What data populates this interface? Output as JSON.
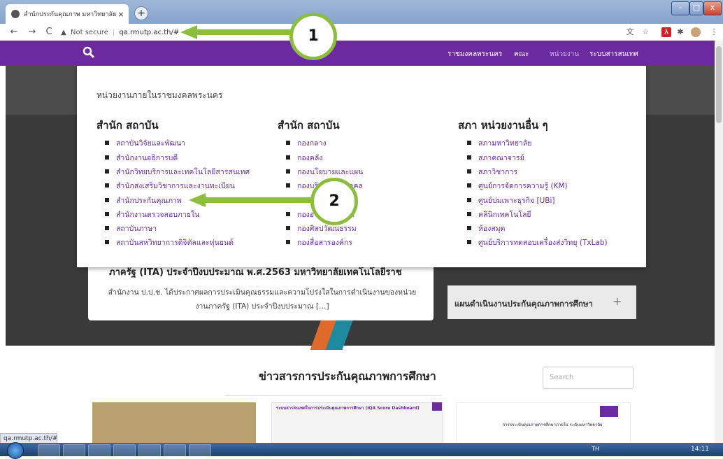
{
  "browser": {
    "tab_title": "สำนักประกันคุณภาพ มหาวิทยาลัยเ",
    "tab_close": "×",
    "new_tab": "+",
    "nav_back": "←",
    "nav_forward": "→",
    "nav_reload": "C",
    "not_secure_label": "Not secure",
    "separator": "|",
    "url": "qa.rmutp.ac.th/#",
    "window_min": "–",
    "window_max": "□",
    "window_close": "x",
    "status_url": "qa.rmutp.ac.th/#"
  },
  "site_nav": {
    "items": [
      "ราชมงคลพระนคร",
      "คณะ",
      "หน่วยงาน",
      "ระบบสารสนเทศ"
    ]
  },
  "mega_menu": {
    "title": "หน่วยงานภายในราชมงคลพระนคร",
    "columns": [
      {
        "heading": "สำนัก สถาบัน",
        "items": [
          "สถาบันวิจัยและพัฒนา",
          "สำนักงานอธิการบดี",
          "สำนักวิทยบริการและเทคโนโลยีสารสนเทศ",
          "สำนักส่งเสริมวิชาการและงานทะเบียน",
          "สำนักประกันคุณภาพ",
          "สำนักงานตรวจสอบภายใน",
          "สถาบันภาษา",
          "สถาบันสหวิทยาการดิจิตัลและหุ่นยนต์"
        ]
      },
      {
        "heading": "สำนัก สถาบัน",
        "items": [
          "กองกลาง",
          "กองคลัง",
          "กองนโยบายและแผน",
          "กองบริหารงานบุคคล",
          "กองพัฒนานักศึกษา",
          "กองอาคารสถานที่",
          "กองศิลปวัฒนธรรม",
          "กองสื่อสารองค์กร"
        ]
      },
      {
        "heading": "สภา หน่วยงานอื่น ๆ",
        "items": [
          "สภามหาวิทยาลัย",
          "สภาคณาจารย์",
          "สภาวิชาการ",
          "ศูนย์การจัดการความรู้ (KM)",
          "ศูนย์บ่มเพาะธุรกิจ [UBi]",
          "คลินิกเทคโนโลยี",
          "ห้องสมุด",
          "ศูนย์บริการทดสอบเครื่องส่งวิทยุ (TxLab)"
        ]
      }
    ]
  },
  "article": {
    "title": "ภาครัฐ (ITA) ประจำปีงบประมาณ พ.ศ.2563 มหาวิทยาลัยเทคโนโลยีราช",
    "body": "สำนักงาน ป.ป.ช. ได้ประกาศผลการประเมินคุณธรรมและความโปร่งใสในการดำเนินงานของหน่วยงานภาครัฐ (ITA) ประจำปีงบประมาณ […]"
  },
  "side_panel": {
    "label": "แผนดำเนินงานประกันคุณภาพการศึกษา",
    "plus": "+"
  },
  "news": {
    "title": "ข่าวสารการประกันคุณภาพการศึกษา",
    "search_placeholder": "Search",
    "thumb2_heading": "ระบบสารสนเทศในการประเมินคุณภาพการศึกษา (IQA Score Dashboard)",
    "thumb3_text": "การประเมินคุณภาพการศึกษาภายใน ระดับมหาวิทยาลัย"
  },
  "callouts": [
    "1",
    "2"
  ],
  "taskbar": {
    "tray": "TH",
    "clock": "14:11"
  },
  "colors": {
    "brand_purple": "#6b2aa0",
    "callout_green": "#8cbd3e"
  }
}
